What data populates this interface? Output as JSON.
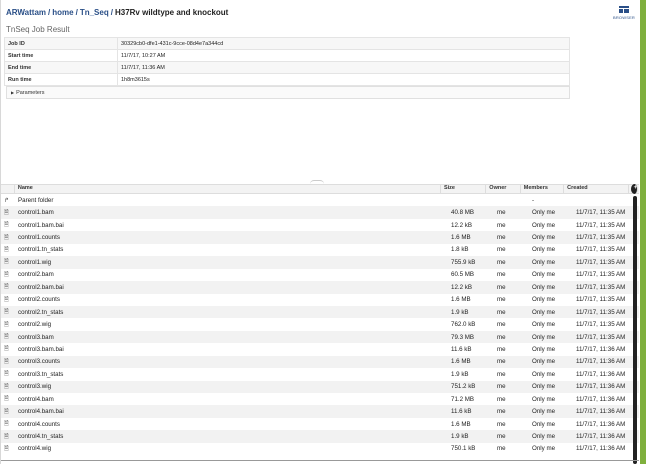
{
  "breadcrumb": {
    "user": "ARWattam",
    "home": "home",
    "folder": "Tn_Seq",
    "current": "H37Rv wildtype and knockout"
  },
  "browser_label": "BROWSER",
  "job": {
    "title": "TnSeq Job Result",
    "fields": [
      {
        "label": "Job ID",
        "value": "30329cb0-dfe1-431c-9cce-08d4e7a344cd"
      },
      {
        "label": "Start time",
        "value": "11/7/17, 10:27 AM"
      },
      {
        "label": "End time",
        "value": "11/7/17, 11:36 AM"
      },
      {
        "label": "Run time",
        "value": "1h8m3615s"
      }
    ],
    "parameters_label": "Parameters"
  },
  "grid": {
    "columns": {
      "name": "Name",
      "size": "Size",
      "owner": "Owner",
      "members": "Members",
      "created": "Created"
    },
    "parent": {
      "name": "Parent folder",
      "members": "-"
    },
    "rows": [
      {
        "name": "control1.bam",
        "size": "40.8 MB",
        "owner": "me",
        "members": "Only me",
        "created": "11/7/17, 11:35 AM"
      },
      {
        "name": "control1.bam.bai",
        "size": "12.2 kB",
        "owner": "me",
        "members": "Only me",
        "created": "11/7/17, 11:35 AM"
      },
      {
        "name": "control1.counts",
        "size": "1.6 MB",
        "owner": "me",
        "members": "Only me",
        "created": "11/7/17, 11:35 AM"
      },
      {
        "name": "control1.tn_stats",
        "size": "1.8 kB",
        "owner": "me",
        "members": "Only me",
        "created": "11/7/17, 11:35 AM"
      },
      {
        "name": "control1.wig",
        "size": "755.9 kB",
        "owner": "me",
        "members": "Only me",
        "created": "11/7/17, 11:35 AM"
      },
      {
        "name": "control2.bam",
        "size": "60.5 MB",
        "owner": "me",
        "members": "Only me",
        "created": "11/7/17, 11:35 AM"
      },
      {
        "name": "control2.bam.bai",
        "size": "12.2 kB",
        "owner": "me",
        "members": "Only me",
        "created": "11/7/17, 11:35 AM"
      },
      {
        "name": "control2.counts",
        "size": "1.6 MB",
        "owner": "me",
        "members": "Only me",
        "created": "11/7/17, 11:35 AM"
      },
      {
        "name": "control2.tn_stats",
        "size": "1.9 kB",
        "owner": "me",
        "members": "Only me",
        "created": "11/7/17, 11:35 AM"
      },
      {
        "name": "control2.wig",
        "size": "762.0 kB",
        "owner": "me",
        "members": "Only me",
        "created": "11/7/17, 11:35 AM"
      },
      {
        "name": "control3.bam",
        "size": "79.3 MB",
        "owner": "me",
        "members": "Only me",
        "created": "11/7/17, 11:35 AM"
      },
      {
        "name": "control3.bam.bai",
        "size": "11.6 kB",
        "owner": "me",
        "members": "Only me",
        "created": "11/7/17, 11:36 AM"
      },
      {
        "name": "control3.counts",
        "size": "1.6 MB",
        "owner": "me",
        "members": "Only me",
        "created": "11/7/17, 11:36 AM"
      },
      {
        "name": "control3.tn_stats",
        "size": "1.9 kB",
        "owner": "me",
        "members": "Only me",
        "created": "11/7/17, 11:36 AM"
      },
      {
        "name": "control3.wig",
        "size": "751.2 kB",
        "owner": "me",
        "members": "Only me",
        "created": "11/7/17, 11:36 AM"
      },
      {
        "name": "control4.bam",
        "size": "71.2 MB",
        "owner": "me",
        "members": "Only me",
        "created": "11/7/17, 11:36 AM"
      },
      {
        "name": "control4.bam.bai",
        "size": "11.6 kB",
        "owner": "me",
        "members": "Only me",
        "created": "11/7/17, 11:36 AM"
      },
      {
        "name": "control4.counts",
        "size": "1.6 MB",
        "owner": "me",
        "members": "Only me",
        "created": "11/7/17, 11:36 AM"
      },
      {
        "name": "control4.tn_stats",
        "size": "1.9 kB",
        "owner": "me",
        "members": "Only me",
        "created": "11/7/17, 11:36 AM"
      },
      {
        "name": "control4.wig",
        "size": "750.1 kB",
        "owner": "me",
        "members": "Only me",
        "created": "11/7/17, 11:36 AM"
      }
    ]
  },
  "icons": {
    "parent": "folder-up-icon",
    "file": "file-icon",
    "add": "plus-circle-icon",
    "browser": "browser-icon"
  },
  "colors": {
    "accent_green": "#7fb03d",
    "link_blue": "#2a4f87"
  }
}
